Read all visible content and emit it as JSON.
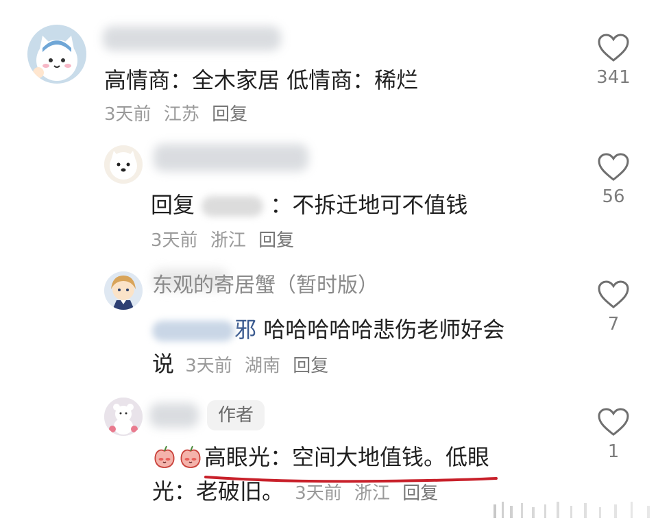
{
  "comments": [
    {
      "text": "高情商：全木家居 低情商：稀烂",
      "time": "3天前",
      "location": "江苏",
      "reply": "回复",
      "likes": "341"
    },
    {
      "reply_prefix": "回复",
      "text": "：不拆迁地可不值钱",
      "time": "3天前",
      "location": "浙江",
      "reply": "回复",
      "likes": "56"
    },
    {
      "username": "东观的寄居蟹（暂时版）",
      "mention_tail": "邪",
      "text_line1": "哈哈哈哈哈悲伤老师好会",
      "text_line2": "说",
      "time": "3天前",
      "location": "湖南",
      "reply": "回复",
      "likes": "7"
    },
    {
      "badge": "作者",
      "text_line1": "高眼光：空间大地值钱。低眼",
      "text_line2": "光：老破旧。",
      "time": "3天前",
      "location": "浙江",
      "reply": "回复",
      "likes": "1"
    }
  ],
  "icons": {
    "like": "heart-outline-icon",
    "emoji": "peach-face-emoji"
  },
  "colors": {
    "underline": "#c8202a",
    "meta": "#9a9a9a",
    "heart": "#6f6f6f"
  }
}
